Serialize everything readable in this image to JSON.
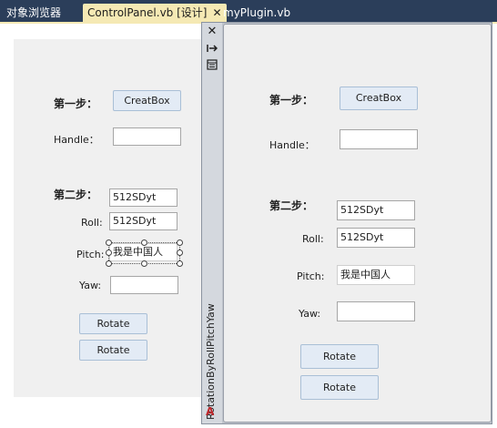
{
  "tabs": [
    {
      "label": "对象浏览器"
    },
    {
      "label": "ControlPanel.vb [设计]",
      "close": "✕"
    },
    {
      "label": "myPlugin.vb"
    }
  ],
  "designer": {
    "step1": "第一步：",
    "creat_box": "CreatBox",
    "handle_label": "Handle：",
    "handle_value": "",
    "step2": "第二步：",
    "step2_value": "512SDyt",
    "roll_label": "Roll:",
    "roll_value": "512SDyt",
    "pitch_label": "Pitch:",
    "pitch_value": "我是中国人",
    "yaw_label": "Yaw:",
    "yaw_value": "",
    "rotate1": "Rotate",
    "rotate2": "Rotate"
  },
  "dock": {
    "title": "RotationByRollPitchYaw",
    "icons": {
      "close": "close-icon",
      "autohide": "pin-icon",
      "properties": "properties-icon"
    },
    "step1": "第一步：",
    "creat_box": "CreatBox",
    "handle_label": "Handle：",
    "handle_value": "",
    "step2": "第二步：",
    "step2_value": "512SDyt",
    "roll_label": "Roll:",
    "roll_value": "512SDyt",
    "pitch_label": "Pitch:",
    "pitch_value": "我是中国人",
    "yaw_label": "Yaw:",
    "yaw_value": "",
    "rotate1": "Rotate",
    "rotate2": "Rotate",
    "app_glyph": "A"
  }
}
